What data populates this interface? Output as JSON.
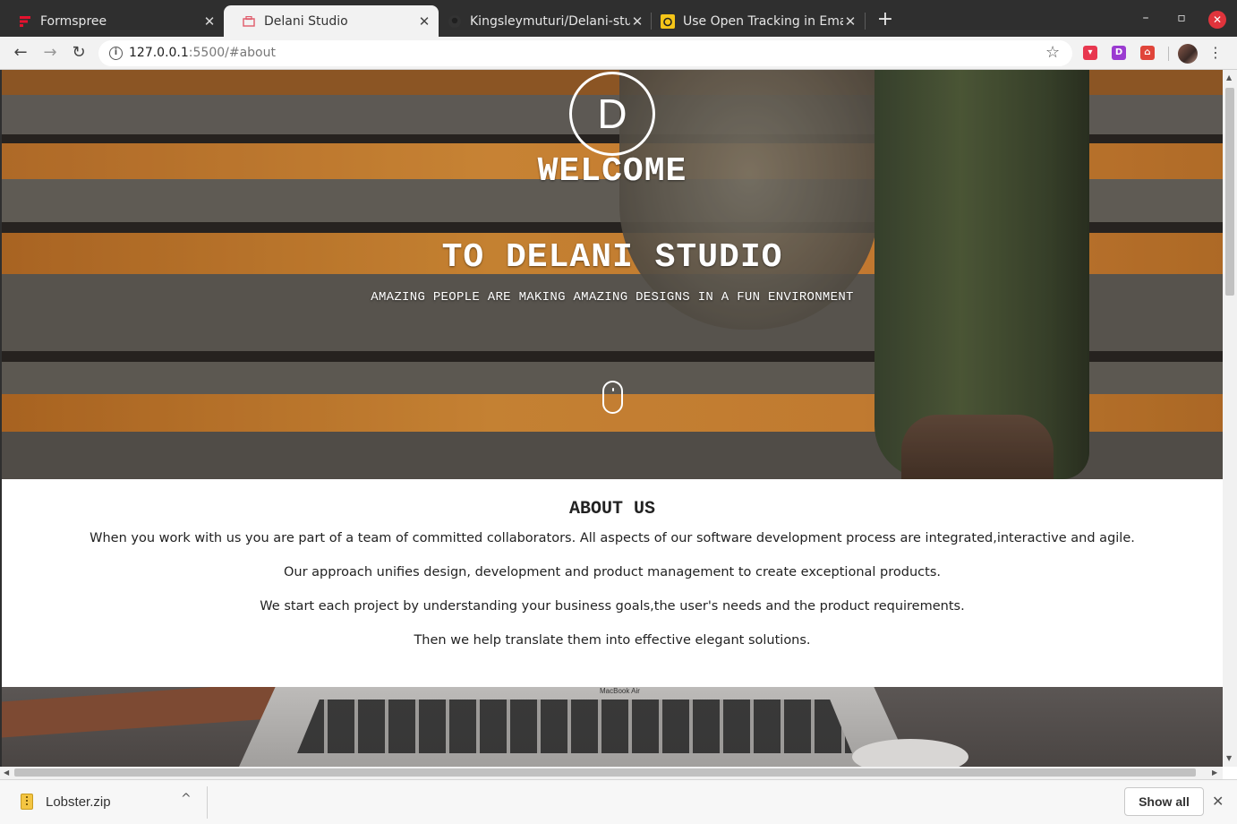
{
  "browser": {
    "tabs": [
      {
        "title": "Formspree",
        "favicon": "formspree-icon",
        "active": false
      },
      {
        "title": "Delani Studio",
        "favicon": "delani-favicon",
        "active": true
      },
      {
        "title": "Kingsleymuturi/Delani-stu",
        "favicon": "github-icon",
        "active": false
      },
      {
        "title": "Use Open Tracking in Ema",
        "favicon": "mailchimp-icon",
        "active": false
      }
    ],
    "close_glyph": "✕",
    "new_tab_glyph": "+",
    "window": {
      "minimize": "–",
      "maximize": "▫",
      "close": "✕"
    },
    "url_host": "127.0.0.1",
    "url_rest": ":5500/#about",
    "nav": {
      "back": "←",
      "forward": "→",
      "reload": "↻"
    },
    "info_glyph": "i",
    "star_glyph": "☆",
    "menu_glyph": "⋮",
    "extensions": [
      {
        "name": "pocket-extension-icon",
        "color": "#e8374f",
        "glyph": "▾"
      },
      {
        "name": "d-extension-icon",
        "color": "#9b3bd1",
        "glyph": "D"
      },
      {
        "name": "house-extension-icon",
        "color": "#e0453a",
        "glyph": "⌂"
      }
    ]
  },
  "hero": {
    "logo_letter": "D",
    "welcome": "WELCOME",
    "title": "TO DELANI STUDIO",
    "tagline": "AMAZING PEOPLE ARE MAKING AMAZING DESIGNS IN A FUN ENVIRONMENT"
  },
  "about": {
    "heading": "ABOUT US",
    "paragraphs": [
      "When you work with us you are part of a team of committed collaborators. All aspects of our software development process are integrated,interactive and agile.",
      "Our approach unifies design, development and product management to create exceptional products.",
      "We start each project by understanding your business goals,the user's needs and the product requirements.",
      "Then we help translate them into effective elegant solutions."
    ]
  },
  "laptop_label": "MacBook Air",
  "download": {
    "filename": "Lobster.zip",
    "chevron": "^",
    "show_all": "Show all",
    "close": "✕"
  },
  "scroll": {
    "up": "▲",
    "down": "▼",
    "left": "◀",
    "right": "▶"
  },
  "colors": {
    "stripe_orange": "#e8933a",
    "stripe_grey": "#6f6c66",
    "tabstrip": "#2f2f2f",
    "close_red": "#e0343c"
  }
}
